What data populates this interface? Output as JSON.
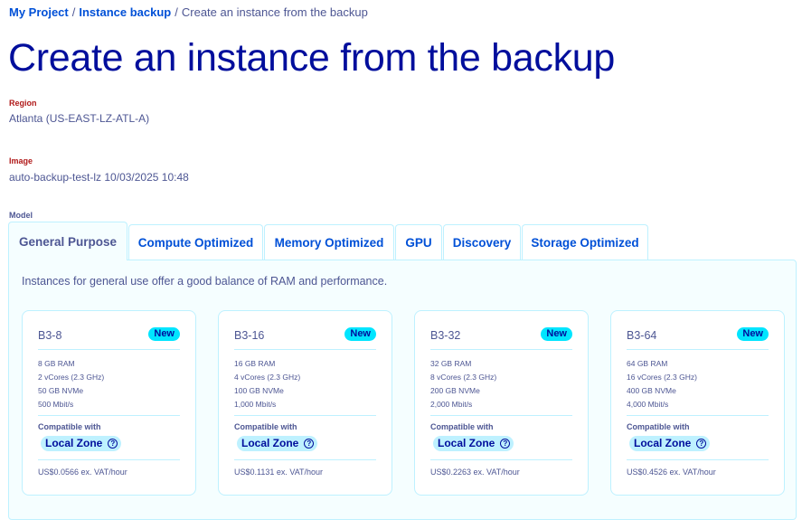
{
  "breadcrumb": {
    "items": [
      "My Project",
      "Instance backup"
    ],
    "separator": "/",
    "current": "Create an instance from the backup"
  },
  "page_title": "Create an instance from the backup",
  "region": {
    "label": "Region",
    "value": "Atlanta (US-EAST-LZ-ATL-A)"
  },
  "image": {
    "label": "Image",
    "value": "auto-backup-test-lz 10/03/2025 10:48"
  },
  "model": {
    "label": "Model",
    "tabs": [
      {
        "label": "General Purpose",
        "active": true
      },
      {
        "label": "Compute Optimized",
        "active": false
      },
      {
        "label": "Memory Optimized",
        "active": false
      },
      {
        "label": "GPU",
        "active": false
      },
      {
        "label": "Discovery",
        "active": false
      },
      {
        "label": "Storage Optimized",
        "active": false
      }
    ],
    "description": "Instances for general use offer a good balance of RAM and performance.",
    "cards": [
      {
        "name": "B3-8",
        "badge": "New",
        "ram": "8 GB RAM",
        "vcores": "2 vCores (2.3 GHz)",
        "storage": "50 GB NVMe",
        "bandwidth": "500 Mbit/s",
        "compat_label": "Compatible with",
        "zone": "Local Zone",
        "price": "US$0.0566 ex. VAT/hour"
      },
      {
        "name": "B3-16",
        "badge": "New",
        "ram": "16 GB RAM",
        "vcores": "4 vCores (2.3 GHz)",
        "storage": "100 GB NVMe",
        "bandwidth": "1,000 Mbit/s",
        "compat_label": "Compatible with",
        "zone": "Local Zone",
        "price": "US$0.1131 ex. VAT/hour"
      },
      {
        "name": "B3-32",
        "badge": "New",
        "ram": "32 GB RAM",
        "vcores": "8 vCores (2.3 GHz)",
        "storage": "200 GB NVMe",
        "bandwidth": "2,000 Mbit/s",
        "compat_label": "Compatible with",
        "zone": "Local Zone",
        "price": "US$0.2263 ex. VAT/hour"
      },
      {
        "name": "B3-64",
        "badge": "New",
        "ram": "64 GB RAM",
        "vcores": "16 vCores (2.3 GHz)",
        "storage": "400 GB NVMe",
        "bandwidth": "4,000 Mbit/s",
        "compat_label": "Compatible with",
        "zone": "Local Zone",
        "price": "US$0.4526 ex. VAT/hour"
      }
    ]
  },
  "icons": {
    "help": "question-circle-icon"
  },
  "colors": {
    "link": "#0050d7",
    "title": "#000e9c",
    "required_label": "#b01919",
    "badge": "#00e5ff",
    "zone_pill": "#bef1ff",
    "panel_bg": "#f5feff"
  }
}
